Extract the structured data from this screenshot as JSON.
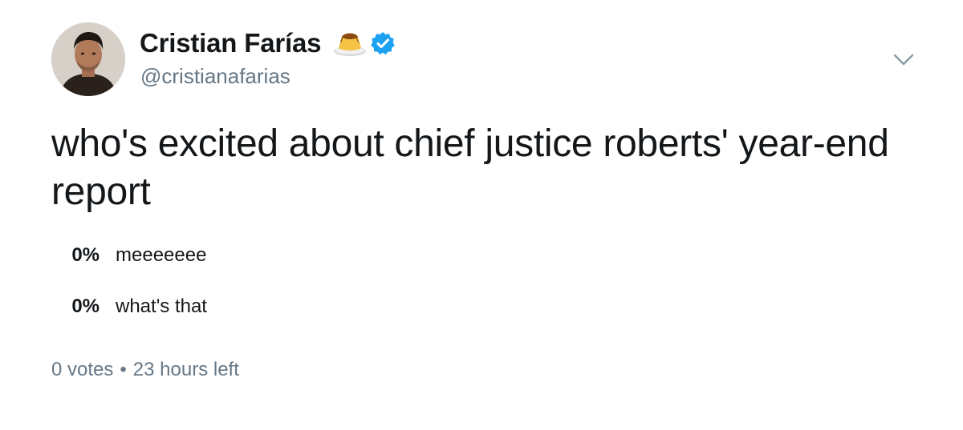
{
  "user": {
    "display_name": "Cristian Farías",
    "handle": "@cristianafarias",
    "emoji": "flan-custard-icon",
    "verified": true
  },
  "tweet": {
    "text": "who's excited about chief justice roberts' year-end report"
  },
  "poll": {
    "choices": [
      {
        "percent": "0%",
        "label": "meeeeeee",
        "fraction": 0
      },
      {
        "percent": "0%",
        "label": "what's that",
        "fraction": 0
      }
    ],
    "votes": "0 votes",
    "separator": "•",
    "time_left": "23 hours left"
  },
  "colors": {
    "text": "#14171a",
    "secondary": "#657786",
    "verified": "#1da1f2"
  }
}
